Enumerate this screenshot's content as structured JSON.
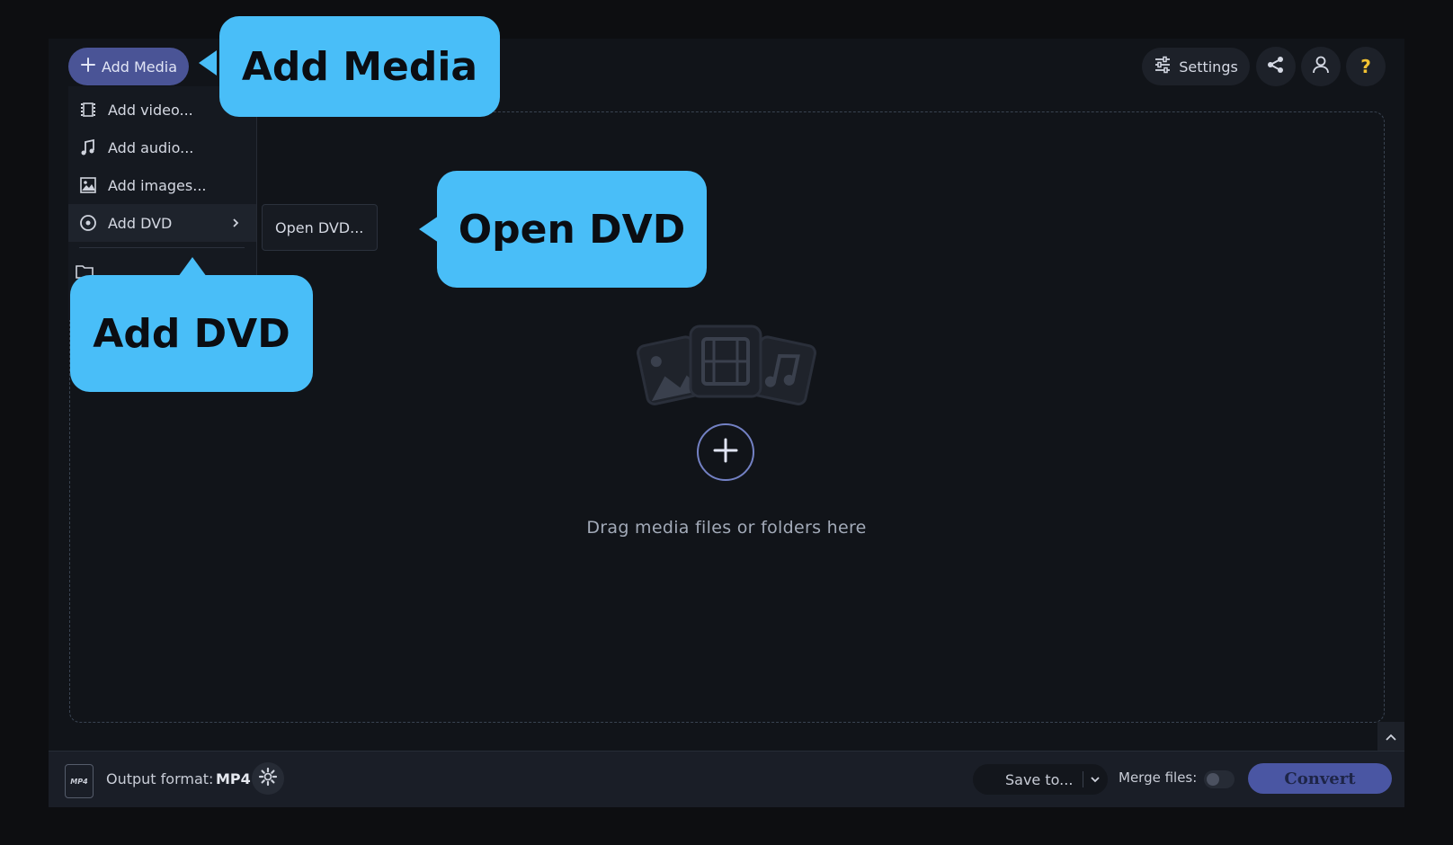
{
  "toolbar": {
    "add_media_label": "Add Media",
    "settings_label": "Settings",
    "help_label": "?"
  },
  "menu": {
    "items": [
      {
        "label": "Add video..."
      },
      {
        "label": "Add audio..."
      },
      {
        "label": "Add images..."
      },
      {
        "label": "Add DVD"
      }
    ],
    "submenu_label": "Open DVD..."
  },
  "dropzone": {
    "text": "Drag media files or folders here"
  },
  "callouts": {
    "add_media": "Add Media",
    "open_dvd": "Open DVD",
    "add_dvd": "Add DVD"
  },
  "bottombar": {
    "output_format_label": "Output format:",
    "output_format_value": "MP4",
    "format_icon_text": "MP4",
    "save_label": "Save to...",
    "merge_label": "Merge files:",
    "convert_label": "Convert"
  },
  "colors": {
    "accent": "#4a5496",
    "callout": "#49bef8",
    "background": "#111419"
  }
}
